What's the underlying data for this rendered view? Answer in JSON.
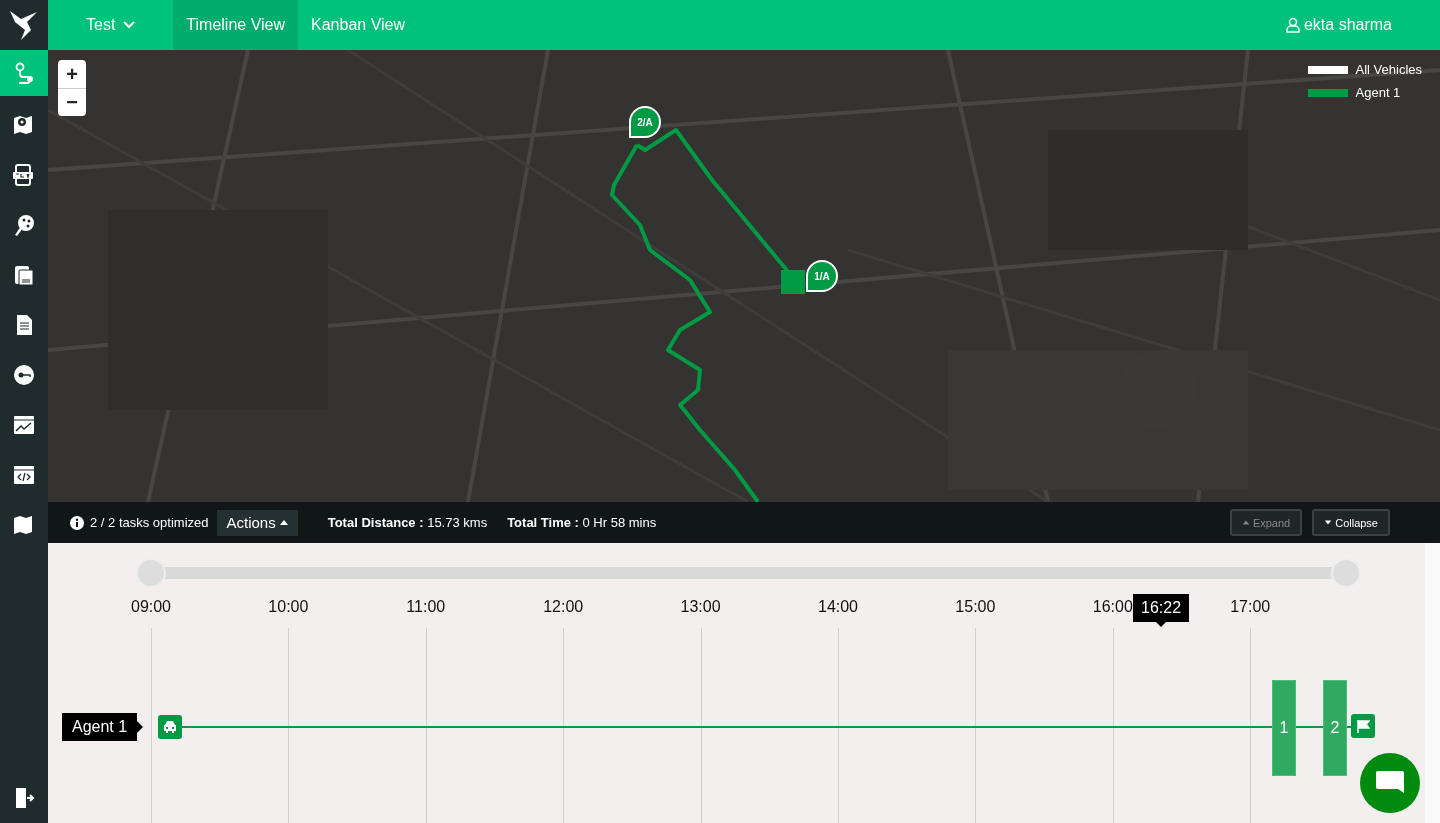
{
  "header": {
    "project": "Test",
    "tabs": [
      {
        "label": "Timeline View",
        "selected": true
      },
      {
        "label": "Kanban View",
        "selected": false
      }
    ],
    "user": "ekta sharma"
  },
  "sidebar": {
    "items": [
      {
        "selected": true
      },
      {
        "selected": false
      },
      {
        "selected": false
      },
      {
        "selected": false
      },
      {
        "selected": false
      },
      {
        "selected": false
      },
      {
        "selected": false
      },
      {
        "selected": false
      },
      {
        "selected": false
      },
      {
        "selected": false
      }
    ]
  },
  "map": {
    "zoom_in": "+",
    "zoom_out": "−",
    "legend": [
      {
        "label": "All Vehicles",
        "color": "#ffffff"
      },
      {
        "label": "Agent 1",
        "color": "#009a44"
      }
    ],
    "markers": [
      {
        "label": "2/A"
      },
      {
        "label": "1/A"
      }
    ]
  },
  "summary": {
    "info": "2 / 2 tasks optimized",
    "actions": "Actions",
    "stats": [
      {
        "label": "Total Distance :",
        "value": "15.73 kms"
      },
      {
        "label": "Total Time :",
        "value": "0 Hr 58 mins"
      }
    ],
    "buttons": [
      {
        "label": "Expand",
        "disabled": true
      },
      {
        "label": "Collapse",
        "disabled": false
      }
    ]
  },
  "timeline": {
    "range_handles": [
      {
        "level": 0
      },
      {
        "level": 1
      }
    ],
    "hours": [
      "09:00",
      "10:00",
      "11:00",
      "12:00",
      "13:00",
      "14:00",
      "15:00",
      "16:00",
      "17:00"
    ],
    "cursor": "16:22",
    "agent": "Agent 1",
    "tasks": [
      "1",
      "2"
    ]
  }
}
